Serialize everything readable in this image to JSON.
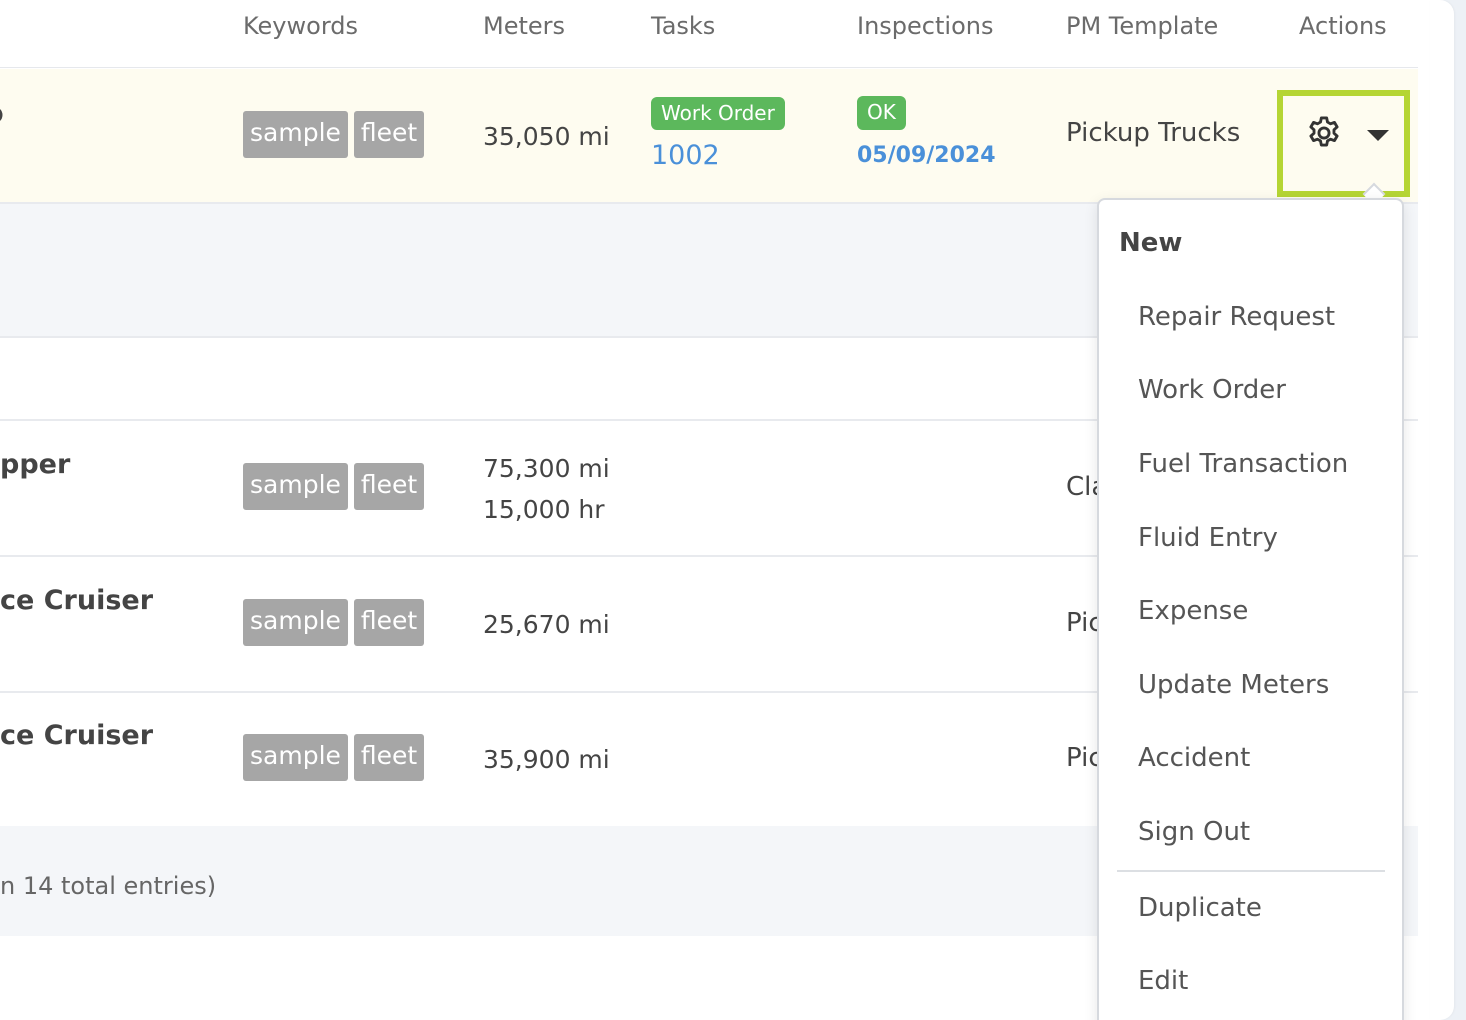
{
  "table": {
    "headers": {
      "keywords": "Keywords",
      "meters": "Meters",
      "tasks": "Tasks",
      "inspections": "Inspections",
      "pm_template": "PM Template",
      "actions": "Actions"
    },
    "rows": [
      {
        "name": "",
        "tags": [
          "sample",
          "fleet"
        ],
        "meters": [
          "35,050 mi"
        ],
        "task_badge": "Work Order",
        "task_link": "1002",
        "inspection_badge": "OK",
        "inspection_date": "05/09/2024",
        "pm_template": "Pickup Trucks"
      },
      {
        "name": "pper",
        "tags": [
          "sample",
          "fleet"
        ],
        "meters": [
          "75,300 mi",
          "15,000 hr"
        ],
        "pm_template": "Cla"
      },
      {
        "name": "ce Cruiser",
        "tags": [
          "sample",
          "fleet"
        ],
        "meters": [
          "25,670 mi"
        ],
        "pm_template": "Pic"
      },
      {
        "name": "ce Cruiser",
        "tags": [
          "sample",
          "fleet"
        ],
        "meters": [
          "35,900 mi"
        ],
        "pm_template": "Pic"
      }
    ],
    "footer_text": "n 14 total entries)"
  },
  "actions": {
    "gear_icon": "gear-icon",
    "caret_icon": "caret-down-icon",
    "highlight_color": "#b5d534"
  },
  "dropdown": {
    "header": "New",
    "items": [
      "Repair Request",
      "Work Order",
      "Fuel Transaction",
      "Fluid Entry",
      "Expense",
      "Update Meters",
      "Accident",
      "Sign Out"
    ],
    "secondary_items": [
      "Duplicate",
      "Edit"
    ]
  },
  "colors": {
    "badge_green": "#5cb85c",
    "link_blue": "#4a90d9",
    "tag_gray": "#a6a6a6",
    "row_highlight": "#fefcf0"
  }
}
